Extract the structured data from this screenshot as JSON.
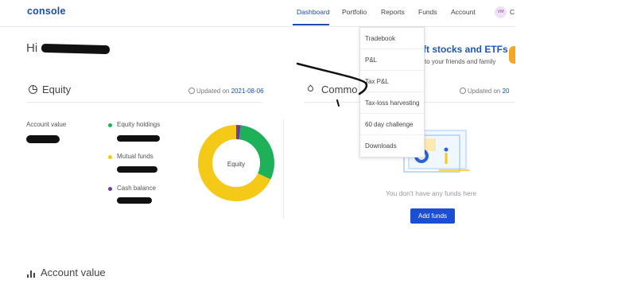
{
  "brand": "console",
  "nav": {
    "dashboard": "Dashboard",
    "portfolio": "Portfolio",
    "reports": "Reports",
    "funds": "Funds",
    "account": "Account"
  },
  "user": {
    "avatar": "VM",
    "trailing_initial": "C"
  },
  "greeting": "Hi",
  "banner": {
    "title": "ft stocks and ETFs",
    "subtitle": "to your friends and family"
  },
  "equity": {
    "title": "Equity",
    "updated_prefix": "Updated on",
    "updated_date": "2021-08-06",
    "account_value_label": "Account value",
    "legend": [
      {
        "label": "Equity holdings",
        "color": "#1fb05a"
      },
      {
        "label": "Mutual funds",
        "color": "#f4c918"
      },
      {
        "label": "Cash balance",
        "color": "#6a3f9a"
      }
    ],
    "donut": {
      "center_label": "Equity",
      "fractions": {
        "equity_holdings": 0.3,
        "mutual_funds": 0.68,
        "cash_balance": 0.02
      }
    }
  },
  "commodity": {
    "title": "Commo",
    "updated_prefix": "Updated on",
    "updated_date": "20",
    "empty_text": "You don't have any funds here",
    "add_funds": "Add funds"
  },
  "reports_menu": [
    "Tradebook",
    "P&L",
    "Tax P&L",
    "Tax-loss harvesting",
    "60 day challenge",
    "Downloads"
  ],
  "bottom": {
    "title": "Account value"
  },
  "colors": {
    "brand": "#1b4fa3",
    "button": "#1b4fd3",
    "equity": "#1fb05a",
    "mutual_funds": "#f4c918",
    "cash": "#6a3f9a"
  },
  "icons": [
    "pie-chart-icon",
    "drop-icon",
    "clock-icon",
    "bar-chart-icon"
  ]
}
